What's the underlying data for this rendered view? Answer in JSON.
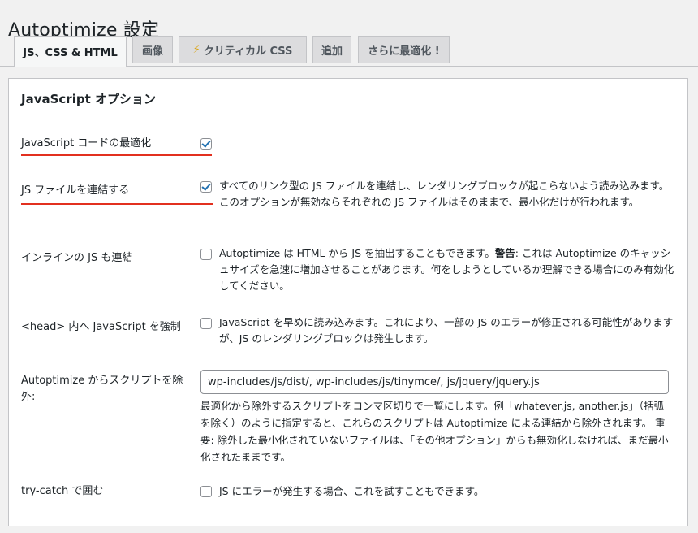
{
  "page": {
    "title": "Autoptimize 設定"
  },
  "tabs": [
    {
      "label": "JS、CSS & HTML"
    },
    {
      "label": "画像"
    },
    {
      "label": "クリティカル CSS",
      "icon": "lightning-icon",
      "icon_glyph": "⚡"
    },
    {
      "label": "追加"
    },
    {
      "label": "さらに最適化 !"
    }
  ],
  "section": {
    "title": "JavaScript オプション",
    "options": [
      {
        "label": "JavaScript コードの最適化",
        "checked": true,
        "description": ""
      },
      {
        "label": "JS ファイルを連結する",
        "checked": true,
        "description": "すべてのリンク型の JS ファイルを連結し、レンダリングブロックが起こらないよう読み込みます。このオプションが無効ならそれぞれの JS ファイルはそのままで、最小化だけが行われます。"
      },
      {
        "label": "インラインの JS も連結",
        "checked": false,
        "description_pre": "Autoptimize は HTML から JS を抽出することもできます。",
        "description_strong": "警告",
        "description_post": ": これは Autoptimize のキャッシュサイズを急速に増加させることがあります。何をしようとしているか理解できる場合にのみ有効化してください。"
      },
      {
        "label": "<head> 内へ JavaScript を強制",
        "checked": false,
        "description": "JavaScript を早めに読み込みます。これにより、一部の JS のエラーが修正される可能性がありますが、JS のレンダリングブロックは発生します。"
      },
      {
        "label": "Autoptimize からスクリプトを除外:",
        "input_value": "wp-includes/js/dist/, wp-includes/js/tinymce/, js/jquery/jquery.js",
        "help": "最適化から除外するスクリプトをコンマ区切りで一覧にします。例「whatever.js, another.js」（括弧を除く）のように指定すると、これらのスクリプトは Autoptimize による連結から除外されます。 重要: 除外した最小化されていないファイルは、「その他オプション」からも無効化しなければ、まだ最小化されたままです。"
      },
      {
        "label": "try-catch で囲む",
        "checked": false,
        "description": "JS にエラーが発生する場合、これを試すこともできます。"
      }
    ]
  },
  "colors": {
    "accent": "#2271b1",
    "highlight_underline": "#e2301f"
  }
}
